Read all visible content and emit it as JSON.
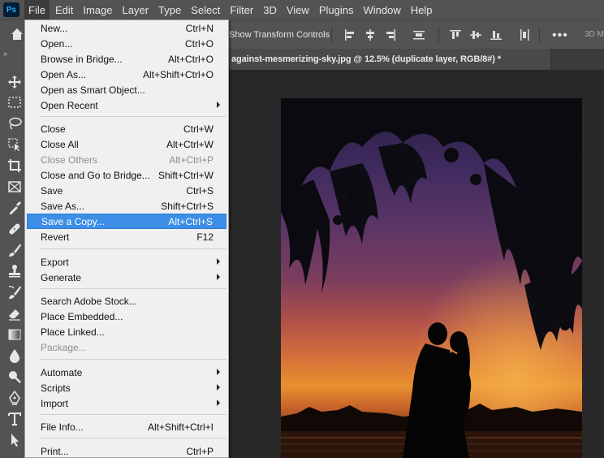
{
  "menubar": {
    "logo": "Ps",
    "items": [
      "File",
      "Edit",
      "Image",
      "Layer",
      "Type",
      "Select",
      "Filter",
      "3D",
      "View",
      "Plugins",
      "Window",
      "Help"
    ]
  },
  "options": {
    "show_transform_label": "Show Transform Controls",
    "mode_3d_label": "3D Mo",
    "more_label": "•••"
  },
  "toolbar": {
    "collapse_label": "»"
  },
  "document": {
    "tab_title": "against-mesmerizing-sky.jpg @ 12.5% (duplicate layer, RGB/8#) *"
  },
  "file_menu": {
    "items": [
      {
        "label": "New...",
        "shortcut": "Ctrl+N"
      },
      {
        "label": "Open...",
        "shortcut": "Ctrl+O"
      },
      {
        "label": "Browse in Bridge...",
        "shortcut": "Alt+Ctrl+O"
      },
      {
        "label": "Open As...",
        "shortcut": "Alt+Shift+Ctrl+O"
      },
      {
        "label": "Open as Smart Object...",
        "shortcut": ""
      },
      {
        "label": "Open Recent",
        "shortcut": ""
      },
      {
        "label": "Close",
        "shortcut": "Ctrl+W"
      },
      {
        "label": "Close All",
        "shortcut": "Alt+Ctrl+W"
      },
      {
        "label": "Close Others",
        "shortcut": "Alt+Ctrl+P"
      },
      {
        "label": "Close and Go to Bridge...",
        "shortcut": "Shift+Ctrl+W"
      },
      {
        "label": "Save",
        "shortcut": "Ctrl+S"
      },
      {
        "label": "Save As...",
        "shortcut": "Shift+Ctrl+S"
      },
      {
        "label": "Save a Copy...",
        "shortcut": "Alt+Ctrl+S"
      },
      {
        "label": "Revert",
        "shortcut": "F12"
      },
      {
        "label": "Export",
        "shortcut": ""
      },
      {
        "label": "Generate",
        "shortcut": ""
      },
      {
        "label": "Search Adobe Stock...",
        "shortcut": ""
      },
      {
        "label": "Place Embedded...",
        "shortcut": ""
      },
      {
        "label": "Place Linked...",
        "shortcut": ""
      },
      {
        "label": "Package...",
        "shortcut": ""
      },
      {
        "label": "Automate",
        "shortcut": ""
      },
      {
        "label": "Scripts",
        "shortcut": ""
      },
      {
        "label": "Import",
        "shortcut": ""
      },
      {
        "label": "File Info...",
        "shortcut": "Alt+Shift+Ctrl+I"
      },
      {
        "label": "Print...",
        "shortcut": "Ctrl+P"
      }
    ]
  },
  "colors": {
    "highlight": "#3d8ee6",
    "panel": "#535353",
    "menu_bg": "#f0f0f0"
  }
}
